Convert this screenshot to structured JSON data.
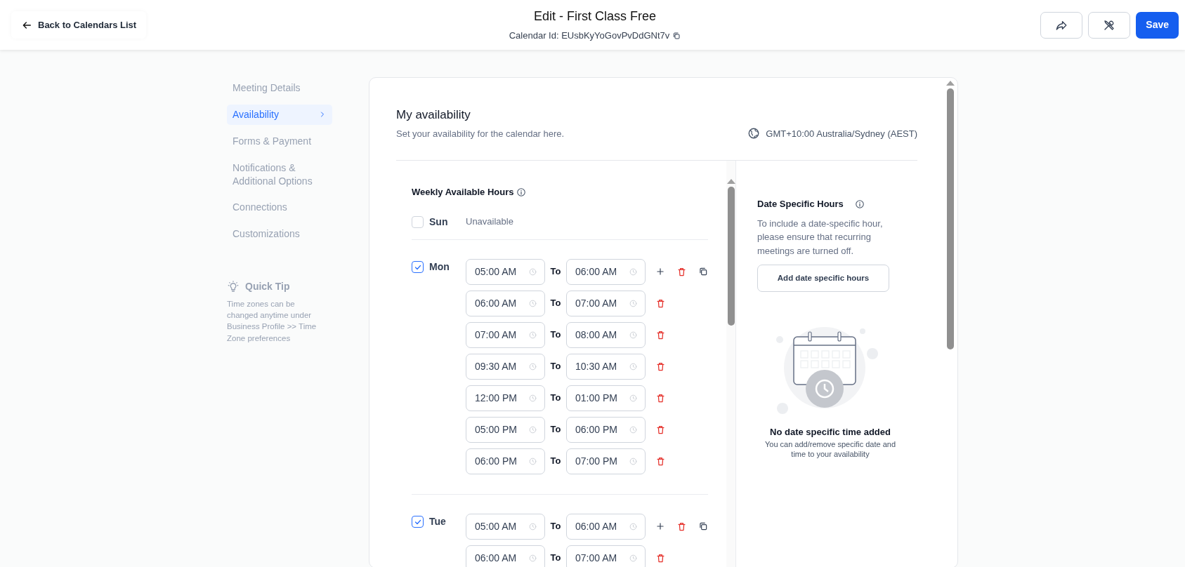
{
  "header": {
    "back_button": "Back to Calendars List",
    "title": "Edit - First Class Free",
    "calendar_id": "Calendar Id: EUsbKyYoGovPvDdGNt7v",
    "save_button": "Save"
  },
  "sidebar": {
    "items": [
      {
        "label": "Meeting Details",
        "selected": false
      },
      {
        "label": "Availability",
        "selected": true
      },
      {
        "label": "Forms & Payment",
        "selected": false
      },
      {
        "label": "Notifications & Additional Options",
        "selected": false
      },
      {
        "label": "Connections",
        "selected": false
      },
      {
        "label": "Customizations",
        "selected": false
      }
    ],
    "quick_tip": {
      "title": "Quick Tip",
      "text": "Time zones can be changed anytime under Business Profile >> Time Zone preferences"
    }
  },
  "availability": {
    "title": "My availability",
    "subtitle": "Set your availability for the calendar here.",
    "timezone": "GMT+10:00 Australia/Sydney (AEST)"
  },
  "weekly": {
    "title": "Weekly Available Hours",
    "days": [
      {
        "name": "Sun",
        "checked": false,
        "status": "Unavailable"
      },
      {
        "name": "Mon",
        "checked": true,
        "slots": [
          {
            "from": "05:00 AM",
            "to_label": "To",
            "to": "06:00 AM"
          },
          {
            "from": "06:00 AM",
            "to_label": "To",
            "to": "07:00 AM"
          },
          {
            "from": "07:00 AM",
            "to_label": "To",
            "to": "08:00 AM"
          },
          {
            "from": "09:30 AM",
            "to_label": "To",
            "to": "10:30 AM"
          },
          {
            "from": "12:00 PM",
            "to_label": "To",
            "to": "01:00 PM"
          },
          {
            "from": "05:00 PM",
            "to_label": "To",
            "to": "06:00 PM"
          },
          {
            "from": "06:00 PM",
            "to_label": "To",
            "to": "07:00 PM"
          }
        ]
      },
      {
        "name": "Tue",
        "checked": true,
        "slots": [
          {
            "from": "05:00 AM",
            "to_label": "To",
            "to": "06:00 AM"
          },
          {
            "from": "06:00 AM",
            "to_label": "To",
            "to": "07:00 AM"
          }
        ]
      }
    ]
  },
  "date_specific": {
    "title": "Date Specific Hours",
    "text": "To include a date-specific hour, please ensure that recurring meetings are turned off.",
    "button": "Add date specific hours",
    "empty_title": "No date specific time added",
    "empty_text": "You can add/remove specific date and time to your availability"
  }
}
